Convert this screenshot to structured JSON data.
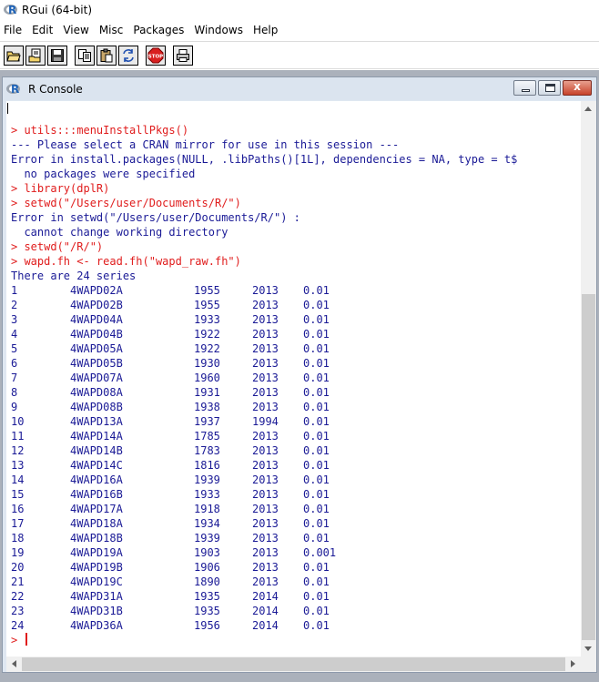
{
  "app": {
    "title": "RGui (64-bit)"
  },
  "menu": [
    "File",
    "Edit",
    "View",
    "Misc",
    "Packages",
    "Windows",
    "Help"
  ],
  "toolbar": {
    "buttons": [
      "open-script-icon",
      "load-workspace-icon",
      "save-workspace-icon",
      "copy-icon",
      "paste-icon",
      "copy-paste-icon",
      "stop-icon",
      "print-icon"
    ],
    "stop_label": "STOP"
  },
  "console": {
    "title": "R Console",
    "controls": {
      "close": "x"
    },
    "lines": [
      {
        "kind": "in",
        "text": "> utils:::menuInstallPkgs()"
      },
      {
        "kind": "out",
        "text": "--- Please select a CRAN mirror for use in this session ---"
      },
      {
        "kind": "out",
        "text": "Error in install.packages(NULL, .libPaths()[1L], dependencies = NA, type = t$"
      },
      {
        "kind": "out",
        "text": "  no packages were specified"
      },
      {
        "kind": "in",
        "text": "> library(dplR)"
      },
      {
        "kind": "in",
        "text": "> setwd(\"/Users/user/Documents/R/\")"
      },
      {
        "kind": "out",
        "text": "Error in setwd(\"/Users/user/Documents/R/\") :"
      },
      {
        "kind": "out",
        "text": "  cannot change working directory"
      },
      {
        "kind": "in",
        "text": "> setwd(\"/R/\")"
      },
      {
        "kind": "in",
        "text": "> wapd.fh <- read.fh(\"wapd_raw.fh\")"
      },
      {
        "kind": "out",
        "text": "There are 24 series"
      }
    ],
    "series_rows": [
      [
        "1",
        "4WAPD02A",
        "1955",
        "2013",
        "0.01"
      ],
      [
        "2",
        "4WAPD02B",
        "1955",
        "2013",
        "0.01"
      ],
      [
        "3",
        "4WAPD04A",
        "1933",
        "2013",
        "0.01"
      ],
      [
        "4",
        "4WAPD04B",
        "1922",
        "2013",
        "0.01"
      ],
      [
        "5",
        "4WAPD05A",
        "1922",
        "2013",
        "0.01"
      ],
      [
        "6",
        "4WAPD05B",
        "1930",
        "2013",
        "0.01"
      ],
      [
        "7",
        "4WAPD07A",
        "1960",
        "2013",
        "0.01"
      ],
      [
        "8",
        "4WAPD08A",
        "1931",
        "2013",
        "0.01"
      ],
      [
        "9",
        "4WAPD08B",
        "1938",
        "2013",
        "0.01"
      ],
      [
        "10",
        "4WAPD13A",
        "1937",
        "1994",
        "0.01"
      ],
      [
        "11",
        "4WAPD14A",
        "1785",
        "2013",
        "0.01"
      ],
      [
        "12",
        "4WAPD14B",
        "1783",
        "2013",
        "0.01"
      ],
      [
        "13",
        "4WAPD14C",
        "1816",
        "2013",
        "0.01"
      ],
      [
        "14",
        "4WAPD16A",
        "1939",
        "2013",
        "0.01"
      ],
      [
        "15",
        "4WAPD16B",
        "1933",
        "2013",
        "0.01"
      ],
      [
        "16",
        "4WAPD17A",
        "1918",
        "2013",
        "0.01"
      ],
      [
        "17",
        "4WAPD18A",
        "1934",
        "2013",
        "0.01"
      ],
      [
        "18",
        "4WAPD18B",
        "1939",
        "2013",
        "0.01"
      ],
      [
        "19",
        "4WAPD19A",
        "1903",
        "2013",
        "0.001"
      ],
      [
        "20",
        "4WAPD19B",
        "1906",
        "2013",
        "0.01"
      ],
      [
        "21",
        "4WAPD19C",
        "1890",
        "2013",
        "0.01"
      ],
      [
        "22",
        "4WAPD31A",
        "1935",
        "2014",
        "0.01"
      ],
      [
        "23",
        "4WAPD31B",
        "1935",
        "2014",
        "0.01"
      ],
      [
        "24",
        "4WAPD36A",
        "1956",
        "2014",
        "0.01"
      ]
    ],
    "prompt": "> "
  },
  "colors": {
    "input": "#e01c1c",
    "output": "#1a1a96",
    "mdi_background": "#abb1bb"
  }
}
